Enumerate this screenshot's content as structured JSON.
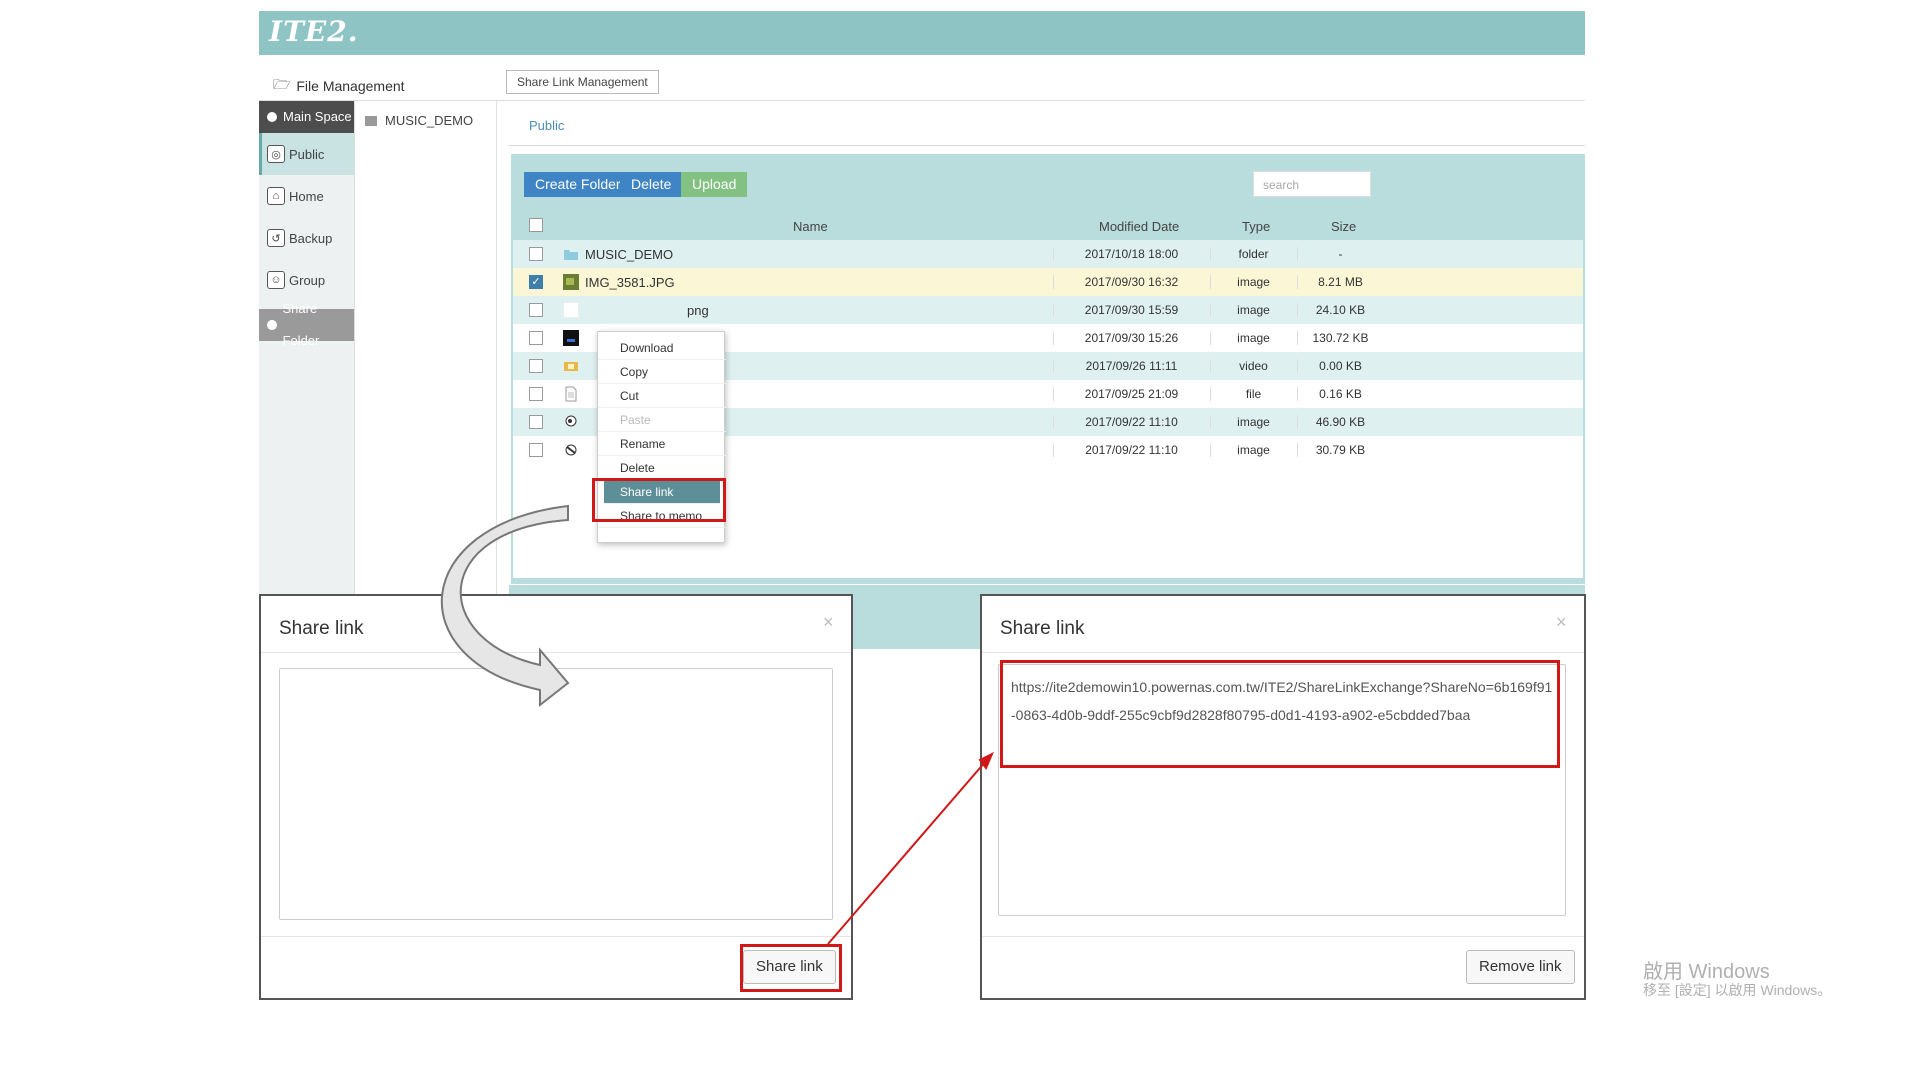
{
  "app": {
    "logo": "ITE2."
  },
  "subnav": {
    "file_management": "File Management",
    "share_link_management": "Share Link Management"
  },
  "sidebar": {
    "main_space": "Main Space",
    "items": [
      {
        "label": "Public",
        "icon": "public-icon"
      },
      {
        "label": "Home",
        "icon": "home-icon"
      },
      {
        "label": "Backup",
        "icon": "backup-icon"
      },
      {
        "label": "Group",
        "icon": "group-icon"
      }
    ],
    "share_folder": "Share Folder"
  },
  "tree": {
    "item": "MUSIC_DEMO"
  },
  "breadcrumb": "Public",
  "toolbar": {
    "create_folder": "Create Folder",
    "delete": "Delete",
    "upload": "Upload",
    "search_placeholder": "search"
  },
  "table": {
    "headers": {
      "name": "Name",
      "modified": "Modified Date",
      "type": "Type",
      "size": "Size"
    },
    "rows": [
      {
        "name": "MUSIC_DEMO",
        "date": "2017/10/18 18:00",
        "type": "folder",
        "size": "-",
        "checked": false
      },
      {
        "name": "IMG_3581.JPG",
        "date": "2017/09/30 16:32",
        "type": "image",
        "size": "8.21 MB",
        "checked": true
      },
      {
        "name": "png",
        "date": "2017/09/30 15:59",
        "type": "image",
        "size": "24.10 KB",
        "checked": false
      },
      {
        "name": "",
        "date": "2017/09/30 15:26",
        "type": "image",
        "size": "130.72 KB",
        "checked": false
      },
      {
        "name": "",
        "date": "2017/09/26 11:11",
        "type": "video",
        "size": "0.00 KB",
        "checked": false
      },
      {
        "name": "",
        "date": "2017/09/25 21:09",
        "type": "file",
        "size": "0.16 KB",
        "checked": false
      },
      {
        "name": "",
        "date": "2017/09/22 11:10",
        "type": "image",
        "size": "46.90 KB",
        "checked": false
      },
      {
        "name": "",
        "date": "2017/09/22 11:10",
        "type": "image",
        "size": "30.79 KB",
        "checked": false
      }
    ]
  },
  "context_menu": {
    "items": [
      "Download",
      "Copy",
      "Cut",
      "Paste",
      "Rename",
      "Delete",
      "Share link",
      "Share to memo"
    ]
  },
  "modal_left": {
    "title": "Share link",
    "close": "×",
    "button": "Share link"
  },
  "modal_right": {
    "title": "Share link",
    "close": "×",
    "link": "https://ite2demowin10.powernas.com.tw/ITE2/ShareLinkExchange?ShareNo=6b169f91-0863-4d0b-9ddf-255c9cbf9d2828f80795-d0d1-4193-a902-e5cbdded7baa",
    "button": "Remove link"
  },
  "watermark": {
    "line1": "啟用 Windows",
    "line2": "移至 [設定] 以啟用 Windows。"
  },
  "colors": {
    "accent": "#8fc4c4",
    "panel": "#b9dcdc",
    "primary_button": "#3f84c5",
    "upload_button": "#82c182",
    "highlight": "#d01818"
  }
}
